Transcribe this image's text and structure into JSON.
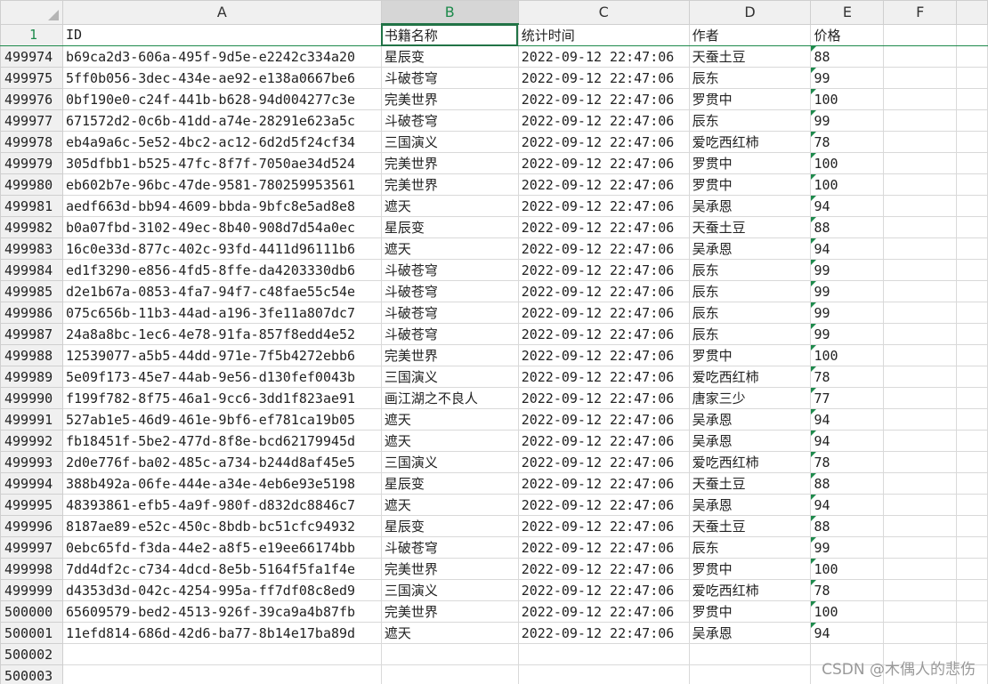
{
  "columns": [
    "A",
    "B",
    "C",
    "D",
    "E",
    "F"
  ],
  "active_column": "B",
  "header_row": {
    "row": "1",
    "cells": [
      "ID",
      "书籍名称",
      "统计时间",
      "作者",
      "价格",
      ""
    ]
  },
  "rows": [
    {
      "row": "499974",
      "id": "b69ca2d3-606a-495f-9d5e-e2242c334a20",
      "book": "星辰变",
      "time": "2022-09-12 22:47:06",
      "author": "天蚕土豆",
      "price": "88"
    },
    {
      "row": "499975",
      "id": "5ff0b056-3dec-434e-ae92-e138a0667be6",
      "book": "斗破苍穹",
      "time": "2022-09-12 22:47:06",
      "author": "辰东",
      "price": "99"
    },
    {
      "row": "499976",
      "id": "0bf190e0-c24f-441b-b628-94d004277c3e",
      "book": "完美世界",
      "time": "2022-09-12 22:47:06",
      "author": "罗贯中",
      "price": "100"
    },
    {
      "row": "499977",
      "id": "671572d2-0c6b-41dd-a74e-28291e623a5c",
      "book": "斗破苍穹",
      "time": "2022-09-12 22:47:06",
      "author": "辰东",
      "price": "99"
    },
    {
      "row": "499978",
      "id": "eb4a9a6c-5e52-4bc2-ac12-6d2d5f24cf34",
      "book": "三国演义",
      "time": "2022-09-12 22:47:06",
      "author": "爱吃西红柿",
      "price": "78"
    },
    {
      "row": "499979",
      "id": "305dfbb1-b525-47fc-8f7f-7050ae34d524",
      "book": "完美世界",
      "time": "2022-09-12 22:47:06",
      "author": "罗贯中",
      "price": "100"
    },
    {
      "row": "499980",
      "id": "eb602b7e-96bc-47de-9581-780259953561",
      "book": "完美世界",
      "time": "2022-09-12 22:47:06",
      "author": "罗贯中",
      "price": "100"
    },
    {
      "row": "499981",
      "id": "aedf663d-bb94-4609-bbda-9bfc8e5ad8e8",
      "book": "遮天",
      "time": "2022-09-12 22:47:06",
      "author": "吴承恩",
      "price": "94"
    },
    {
      "row": "499982",
      "id": "b0a07fbd-3102-49ec-8b40-908d7d54a0ec",
      "book": "星辰变",
      "time": "2022-09-12 22:47:06",
      "author": "天蚕土豆",
      "price": "88"
    },
    {
      "row": "499983",
      "id": "16c0e33d-877c-402c-93fd-4411d96111b6",
      "book": "遮天",
      "time": "2022-09-12 22:47:06",
      "author": "吴承恩",
      "price": "94"
    },
    {
      "row": "499984",
      "id": "ed1f3290-e856-4fd5-8ffe-da4203330db6",
      "book": "斗破苍穹",
      "time": "2022-09-12 22:47:06",
      "author": "辰东",
      "price": "99"
    },
    {
      "row": "499985",
      "id": "d2e1b67a-0853-4fa7-94f7-c48fae55c54e",
      "book": "斗破苍穹",
      "time": "2022-09-12 22:47:06",
      "author": "辰东",
      "price": "99"
    },
    {
      "row": "499986",
      "id": "075c656b-11b3-44ad-a196-3fe11a807dc7",
      "book": "斗破苍穹",
      "time": "2022-09-12 22:47:06",
      "author": "辰东",
      "price": "99"
    },
    {
      "row": "499987",
      "id": "24a8a8bc-1ec6-4e78-91fa-857f8edd4e52",
      "book": "斗破苍穹",
      "time": "2022-09-12 22:47:06",
      "author": "辰东",
      "price": "99"
    },
    {
      "row": "499988",
      "id": "12539077-a5b5-44dd-971e-7f5b4272ebb6",
      "book": "完美世界",
      "time": "2022-09-12 22:47:06",
      "author": "罗贯中",
      "price": "100"
    },
    {
      "row": "499989",
      "id": "5e09f173-45e7-44ab-9e56-d130fef0043b",
      "book": "三国演义",
      "time": "2022-09-12 22:47:06",
      "author": "爱吃西红柿",
      "price": "78"
    },
    {
      "row": "499990",
      "id": "f199f782-8f75-46a1-9cc6-3dd1f823ae91",
      "book": "画江湖之不良人",
      "time": "2022-09-12 22:47:06",
      "author": "唐家三少",
      "price": "77"
    },
    {
      "row": "499991",
      "id": "527ab1e5-46d9-461e-9bf6-ef781ca19b05",
      "book": "遮天",
      "time": "2022-09-12 22:47:06",
      "author": "吴承恩",
      "price": "94"
    },
    {
      "row": "499992",
      "id": "fb18451f-5be2-477d-8f8e-bcd62179945d",
      "book": "遮天",
      "time": "2022-09-12 22:47:06",
      "author": "吴承恩",
      "price": "94"
    },
    {
      "row": "499993",
      "id": "2d0e776f-ba02-485c-a734-b244d8af45e5",
      "book": "三国演义",
      "time": "2022-09-12 22:47:06",
      "author": "爱吃西红柿",
      "price": "78"
    },
    {
      "row": "499994",
      "id": "388b492a-06fe-444e-a34e-4eb6e93e5198",
      "book": "星辰变",
      "time": "2022-09-12 22:47:06",
      "author": "天蚕土豆",
      "price": "88"
    },
    {
      "row": "499995",
      "id": "48393861-efb5-4a9f-980f-d832dc8846c7",
      "book": "遮天",
      "time": "2022-09-12 22:47:06",
      "author": "吴承恩",
      "price": "94"
    },
    {
      "row": "499996",
      "id": "8187ae89-e52c-450c-8bdb-bc51cfc94932",
      "book": "星辰变",
      "time": "2022-09-12 22:47:06",
      "author": "天蚕土豆",
      "price": "88"
    },
    {
      "row": "499997",
      "id": "0ebc65fd-f3da-44e2-a8f5-e19ee66174bb",
      "book": "斗破苍穹",
      "time": "2022-09-12 22:47:06",
      "author": "辰东",
      "price": "99"
    },
    {
      "row": "499998",
      "id": "7dd4df2c-c734-4dcd-8e5b-5164f5fa1f4e",
      "book": "完美世界",
      "time": "2022-09-12 22:47:06",
      "author": "罗贯中",
      "price": "100"
    },
    {
      "row": "499999",
      "id": "d4353d3d-042c-4254-995a-ff7df08c8ed9",
      "book": "三国演义",
      "time": "2022-09-12 22:47:06",
      "author": "爱吃西红柿",
      "price": "78"
    },
    {
      "row": "500000",
      "id": "65609579-bed2-4513-926f-39ca9a4b87fb",
      "book": "完美世界",
      "time": "2022-09-12 22:47:06",
      "author": "罗贯中",
      "price": "100"
    },
    {
      "row": "500001",
      "id": "11efd814-686d-42d6-ba77-8b14e17ba89d",
      "book": "遮天",
      "time": "2022-09-12 22:47:06",
      "author": "吴承恩",
      "price": "94"
    }
  ],
  "empty_rows": [
    "500002",
    "500003"
  ],
  "watermark": "CSDN @木偶人的悲伤",
  "colors": {
    "accent": "#217346",
    "header_bg": "#f0f0f0",
    "grid": "#d9d9d9"
  }
}
